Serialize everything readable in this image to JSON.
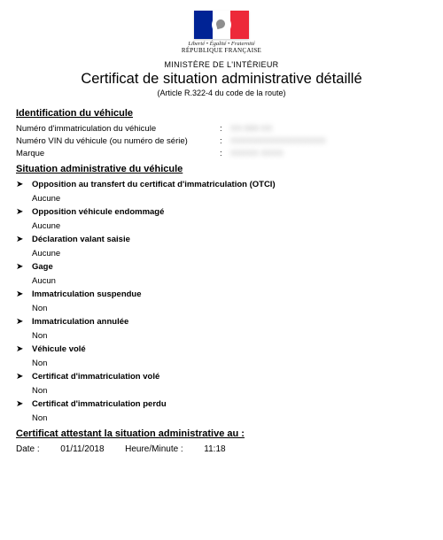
{
  "header": {
    "motto": "Liberté • Égalité • Fraternité",
    "republique": "RÉPUBLIQUE FRANÇAISE",
    "ministry": "MINISTÈRE DE L'INTÉRIEUR",
    "title": "Certificat de situation administrative détaillé",
    "subtitle": "(Article R.322-4 du code de la route)"
  },
  "identification": {
    "section_title": "Identification du véhicule",
    "rows": [
      {
        "label": "Numéro d'immatriculation du véhicule",
        "value": "XX-000-XX"
      },
      {
        "label": "Numéro VIN du véhicule (ou numéro de série)",
        "value": "XXXXXXXXXXXXXXXXX"
      },
      {
        "label": "Marque",
        "value": "XXXXX  XXXX"
      }
    ]
  },
  "situation": {
    "section_title": "Situation administrative du véhicule",
    "items": [
      {
        "label": "Opposition au transfert du certificat d'immatriculation (OTCI)",
        "value": "Aucune"
      },
      {
        "label": "Opposition véhicule endommagé",
        "value": "Aucune"
      },
      {
        "label": "Déclaration valant saisie",
        "value": "Aucune"
      },
      {
        "label": "Gage",
        "value": "Aucun"
      },
      {
        "label": "Immatriculation suspendue",
        "value": "Non"
      },
      {
        "label": "Immatriculation annulée",
        "value": "Non"
      },
      {
        "label": "Véhicule volé",
        "value": "Non"
      },
      {
        "label": "Certificat d'immatriculation volé",
        "value": "Non"
      },
      {
        "label": "Certificat d'immatriculation perdu",
        "value": "Non"
      }
    ]
  },
  "attestation": {
    "section_title": "Certificat attestant la situation administrative au :",
    "date_label": "Date :",
    "date_value": "01/11/2018",
    "time_label": "Heure/Minute :",
    "time_value": "11:18"
  }
}
